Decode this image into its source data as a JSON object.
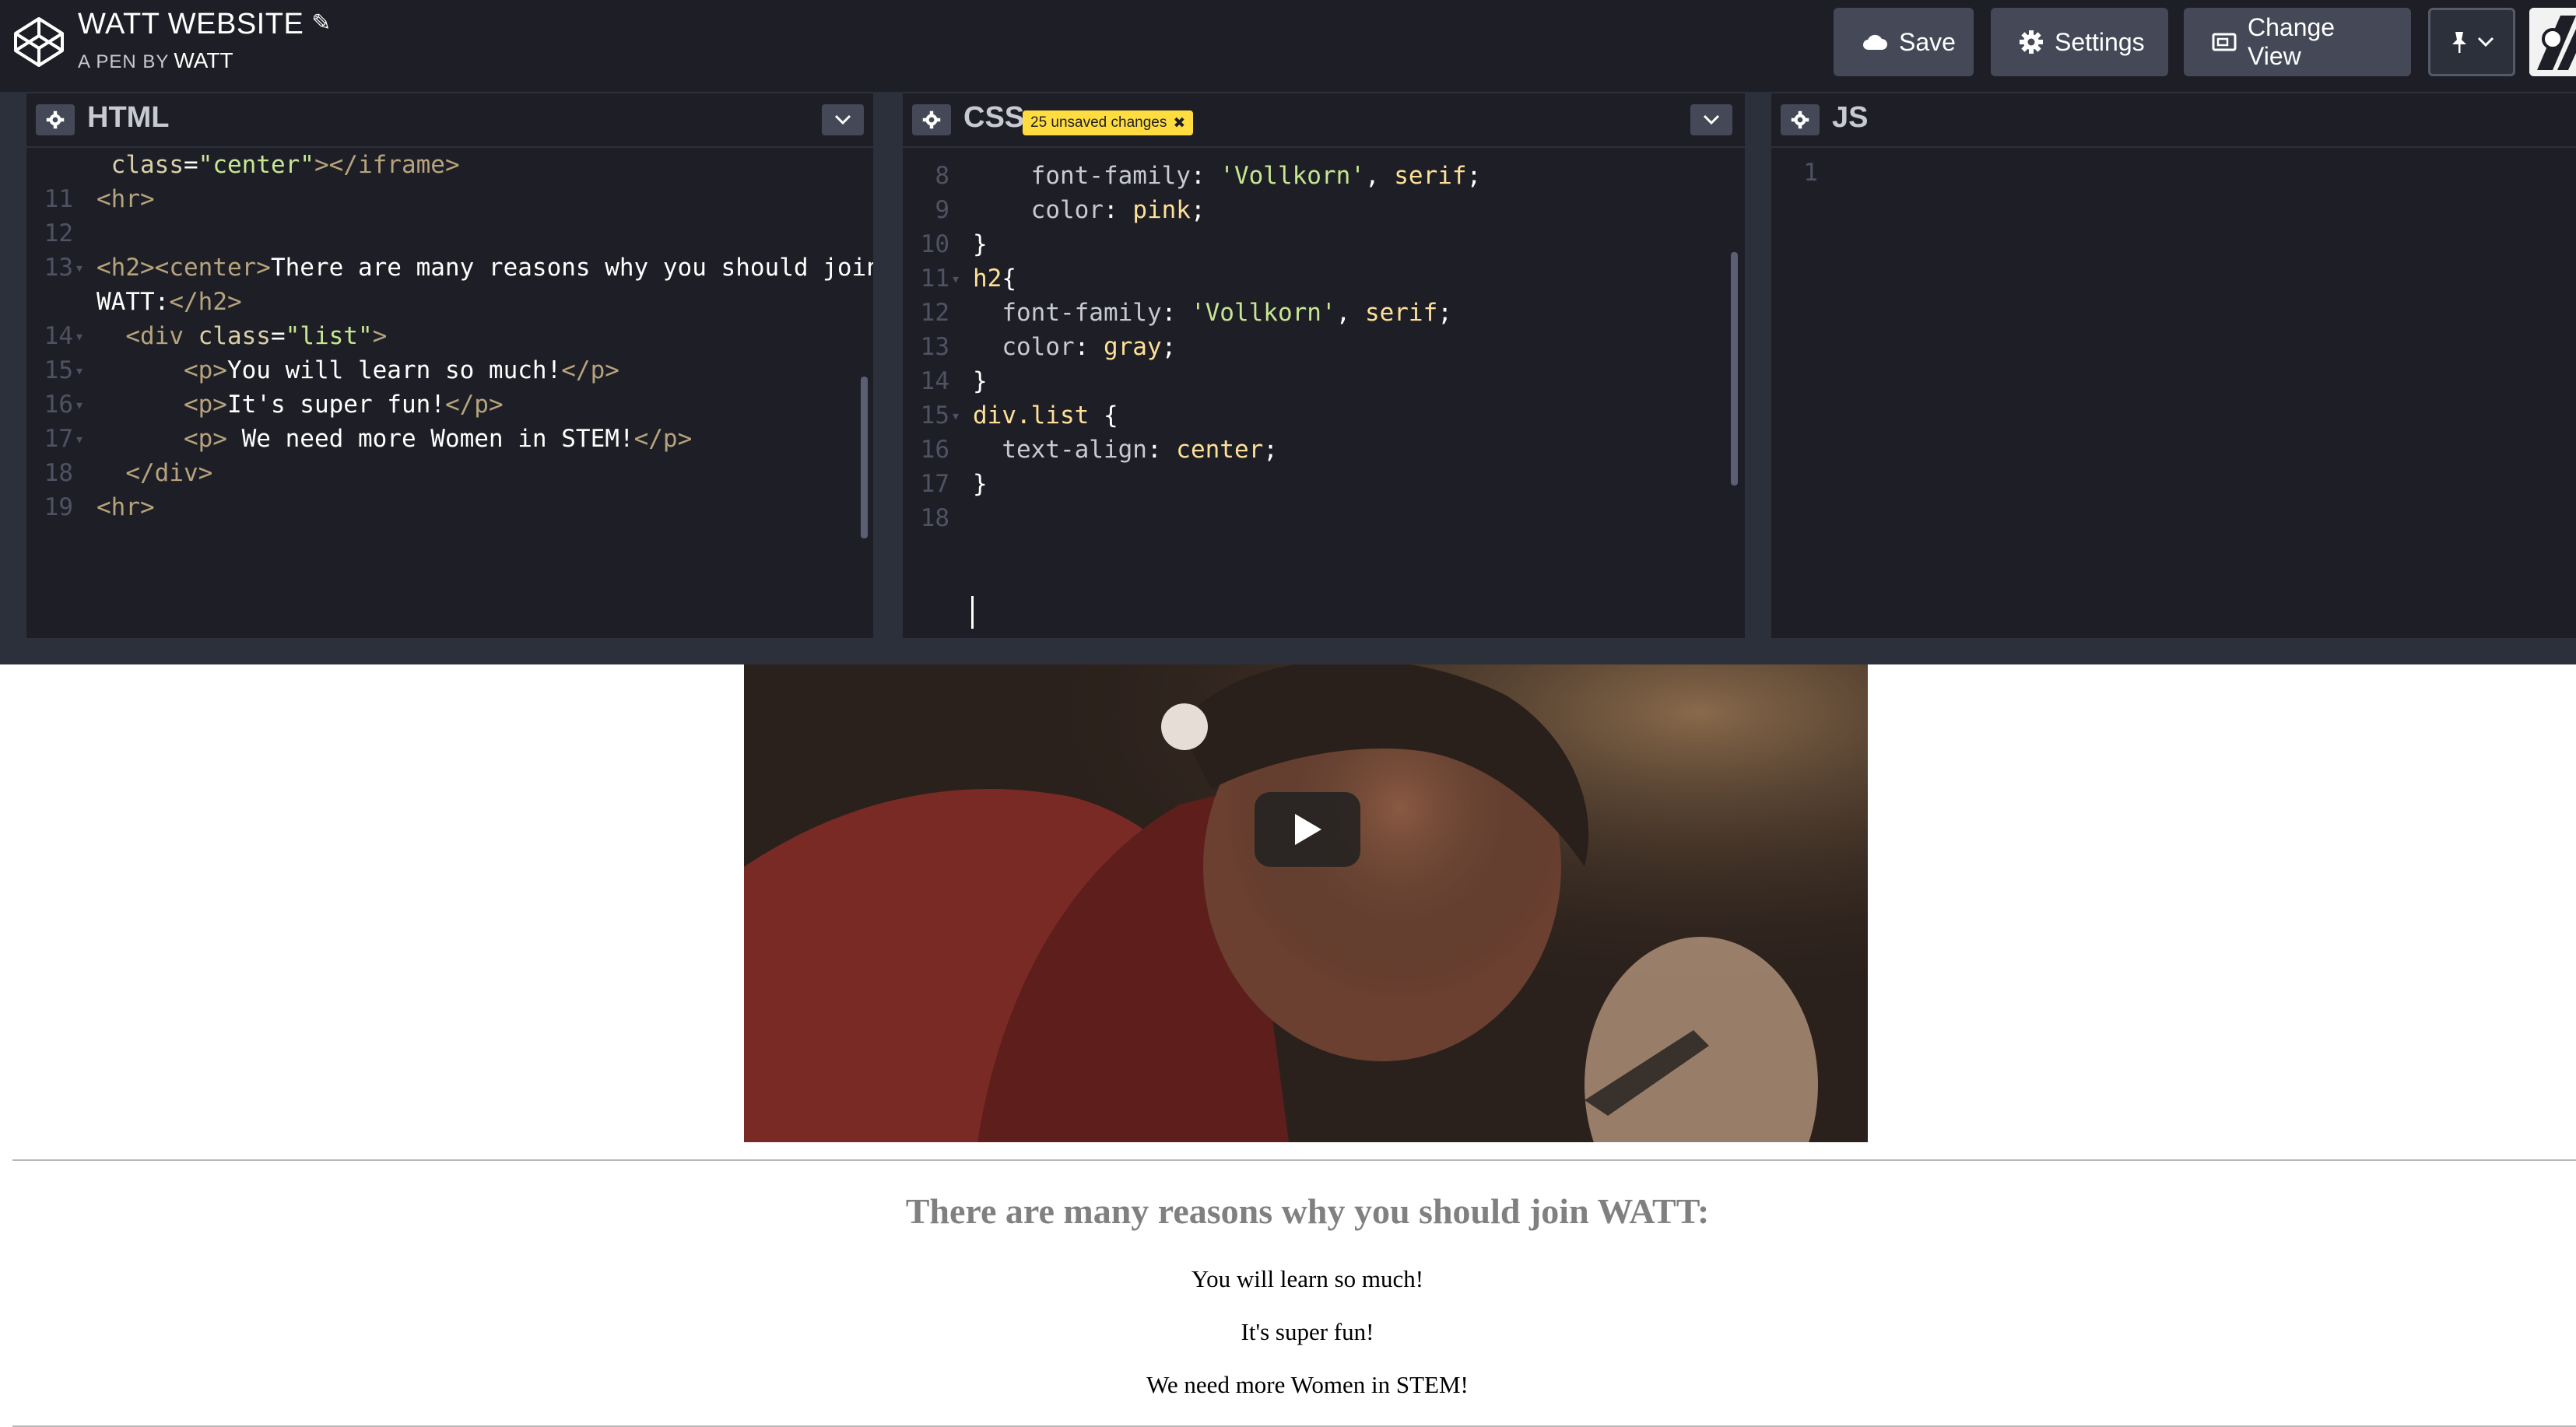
{
  "header": {
    "pen_title": "WATT WEBSITE",
    "pen_meta_prefix": "A PEN BY",
    "author": "WATT",
    "buttons": {
      "save": "Save",
      "settings": "Settings",
      "change_view": "Change View"
    }
  },
  "editors": {
    "html": {
      "title": "HTML",
      "lines": [
        {
          "n": "",
          "parts": [
            {
              "c": "attr",
              "t": " class"
            },
            {
              "c": "plain",
              "t": "="
            },
            {
              "c": "strq",
              "t": "\"center\""
            },
            {
              "c": "tag",
              "t": "></iframe>"
            }
          ]
        },
        {
          "n": "11",
          "parts": [
            {
              "c": "tag",
              "t": "<hr>"
            }
          ]
        },
        {
          "n": "12",
          "parts": []
        },
        {
          "n": "13",
          "parts": [
            {
              "c": "tag",
              "t": "<h2><center>"
            },
            {
              "c": "plain",
              "t": "There are many reasons why you should join"
            }
          ]
        },
        {
          "n": "",
          "parts": [
            {
              "c": "plain",
              "t": "WATT:"
            },
            {
              "c": "tag",
              "t": "</h2>"
            }
          ]
        },
        {
          "n": "14",
          "parts": [
            {
              "c": "tag",
              "t": "  <div "
            },
            {
              "c": "attr",
              "t": "class"
            },
            {
              "c": "plain",
              "t": "="
            },
            {
              "c": "strq",
              "t": "\"list\""
            },
            {
              "c": "tag",
              "t": ">"
            }
          ]
        },
        {
          "n": "15",
          "parts": [
            {
              "c": "tag",
              "t": "      <p>"
            },
            {
              "c": "plain",
              "t": "You will learn so much!"
            },
            {
              "c": "tag",
              "t": "</p>"
            }
          ]
        },
        {
          "n": "16",
          "parts": [
            {
              "c": "tag",
              "t": "      <p>"
            },
            {
              "c": "plain",
              "t": "It's super fun!"
            },
            {
              "c": "tag",
              "t": "</p>"
            }
          ]
        },
        {
          "n": "17",
          "parts": [
            {
              "c": "tag",
              "t": "      <p>"
            },
            {
              "c": "plain",
              "t": " We need more Women in STEM!"
            },
            {
              "c": "tag",
              "t": "</p>"
            }
          ]
        },
        {
          "n": "18",
          "parts": [
            {
              "c": "tag",
              "t": "  </div>"
            }
          ]
        },
        {
          "n": "19",
          "parts": [
            {
              "c": "tag",
              "t": "<hr>"
            }
          ]
        }
      ]
    },
    "css": {
      "title": "CSS",
      "badge": "25 unsaved changes",
      "lines": [
        {
          "n": "8",
          "parts": [
            {
              "c": "prop",
              "t": "    font-family"
            },
            {
              "c": "plain",
              "t": ": "
            },
            {
              "c": "strq",
              "t": "'Vollkorn'"
            },
            {
              "c": "plain",
              "t": ", "
            },
            {
              "c": "val",
              "t": "serif"
            },
            {
              "c": "plain",
              "t": ";"
            }
          ]
        },
        {
          "n": "9",
          "parts": [
            {
              "c": "prop",
              "t": "    color"
            },
            {
              "c": "plain",
              "t": ": "
            },
            {
              "c": "val",
              "t": "pink"
            },
            {
              "c": "plain",
              "t": ";"
            }
          ]
        },
        {
          "n": "10",
          "parts": [
            {
              "c": "plain",
              "t": "}"
            }
          ]
        },
        {
          "n": "11",
          "parts": [
            {
              "c": "sel",
              "t": "h2"
            },
            {
              "c": "plain",
              "t": "{"
            }
          ]
        },
        {
          "n": "12",
          "parts": [
            {
              "c": "prop",
              "t": "  font-family"
            },
            {
              "c": "plain",
              "t": ": "
            },
            {
              "c": "strq",
              "t": "'Vollkorn'"
            },
            {
              "c": "plain",
              "t": ", "
            },
            {
              "c": "val",
              "t": "serif"
            },
            {
              "c": "plain",
              "t": ";"
            }
          ]
        },
        {
          "n": "13",
          "parts": [
            {
              "c": "prop",
              "t": "  color"
            },
            {
              "c": "plain",
              "t": ": "
            },
            {
              "c": "val",
              "t": "gray"
            },
            {
              "c": "plain",
              "t": ";"
            }
          ]
        },
        {
          "n": "14",
          "parts": [
            {
              "c": "plain",
              "t": "}"
            }
          ]
        },
        {
          "n": "15",
          "parts": [
            {
              "c": "sel",
              "t": "div.list"
            },
            {
              "c": "plain",
              "t": " {"
            }
          ]
        },
        {
          "n": "16",
          "parts": [
            {
              "c": "prop",
              "t": "  text-align"
            },
            {
              "c": "plain",
              "t": ": "
            },
            {
              "c": "val",
              "t": "center"
            },
            {
              "c": "plain",
              "t": ";"
            }
          ]
        },
        {
          "n": "17",
          "parts": [
            {
              "c": "plain",
              "t": "}"
            }
          ]
        },
        {
          "n": "18",
          "parts": []
        }
      ]
    },
    "js": {
      "title": "JS",
      "lines": [
        {
          "n": "1",
          "parts": []
        }
      ]
    }
  },
  "preview": {
    "heading": "There are many reasons why you should join WATT:",
    "items": [
      "You will learn so much!",
      "It's super fun!",
      "We need more Women in STEM!"
    ]
  },
  "colors": {
    "header_bg": "#1e1f26",
    "editor_bg": "#1e1f26",
    "button_bg": "#444857",
    "badge_bg": "#ffdd40"
  }
}
